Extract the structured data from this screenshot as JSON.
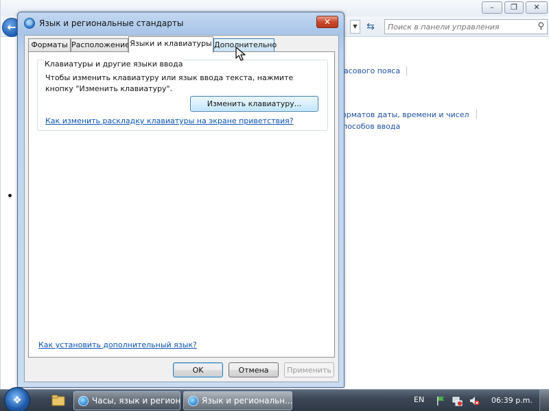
{
  "background_window": {
    "search_placeholder": "Поиск в панели управления",
    "links": [
      "асового пояса",
      "орматов даты, времени и чисел",
      "пособов ввода"
    ]
  },
  "dialog": {
    "title": "Язык и региональные стандарты",
    "tabs": [
      "Форматы",
      "Расположение",
      "Языки и клавиатуры",
      "Дополнительно"
    ],
    "active_tab": "Языки и клавиатуры",
    "hovered_tab": "Дополнительно",
    "group": {
      "title": "Клавиатуры и другие языки ввода",
      "description": "Чтобы изменить клавиатуру или язык ввода текста, нажмите кнопку \"Изменить клавиатуру\".",
      "change_keyboard_button": "Изменить клавиатуру...",
      "welcome_screen_link": "Как изменить раскладку клавиатуры на экране приветствия?"
    },
    "install_language_link": "Как установить дополнительный язык?",
    "buttons": {
      "ok": "OK",
      "cancel": "Отмена",
      "apply": "Применить"
    }
  },
  "taskbar": {
    "items": [
      "Часы, язык и регион",
      "Язык и региональн..."
    ],
    "tray": {
      "language": "EN",
      "clock": "06:39 p.m."
    }
  },
  "colors": {
    "link": "#0b52b3",
    "dialog_frame": "#a9c5e8",
    "close_button": "#c94a2c",
    "taskbar": "#3c4756"
  },
  "icons": [
    "back-arrow-icon",
    "refresh-icon",
    "search-icon",
    "globe-icon",
    "folder-icon",
    "windows-logo-icon",
    "network-icon",
    "volume-muted-icon",
    "flag-icon",
    "mouse-cursor-icon"
  ]
}
